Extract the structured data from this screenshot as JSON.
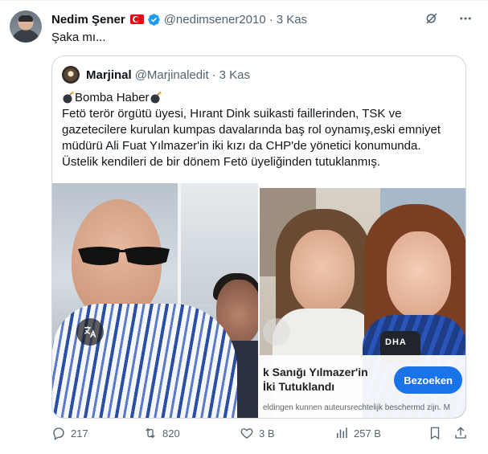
{
  "tweet": {
    "display_name": "Nedim Şener",
    "handle": "@nedimsener2010",
    "separator": "·",
    "time": "3 Kas",
    "text": "Şaka mı..."
  },
  "quote": {
    "display_name": "Marjinal",
    "handle": "@Marjinaledit",
    "separator": "·",
    "time": "3 Kas",
    "headline": "Bomba Haber",
    "body": "Fetö terör örgütü üyesi, Hırant Dink suikasti faillerinden, TSK ve gazetecilere kurulan kumpas davalarında baş rol oynamış,eski emniyet müdürü Ali Fuat Yılmazer'in iki kızı da CHP'de yönetici konumunda. Üstelik kendileri de bir dönem Fetö üyeliğinden tutuklanmış.",
    "media": {
      "overlay_title": "k Sanığı Yılmazer'in İki Tutuklandı",
      "overlay_button": "Bezoeken",
      "overlay_notice": "eldingen kunnen auteursrechtelijk beschermd zijn. M",
      "mic_label": "DHA"
    }
  },
  "actions": {
    "replies": "217",
    "retweets": "820",
    "likes": "3 B",
    "views": "257 B"
  },
  "colors": {
    "text": "#0f1419",
    "muted": "#536471",
    "verified": "#1d9bf0",
    "flag": "#e30a17",
    "ad_button": "#1a73e8"
  },
  "icons": [
    "verified-badge-icon",
    "turkey-flag-icon",
    "grok-icon",
    "more-icon",
    "bomb-icon",
    "translate-icon",
    "reply-icon",
    "retweet-icon",
    "like-icon",
    "views-icon",
    "bookmark-icon",
    "share-icon"
  ]
}
